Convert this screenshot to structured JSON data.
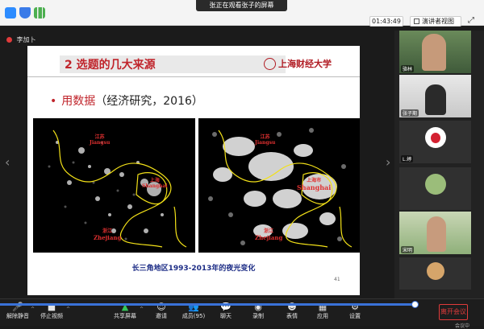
{
  "window": {
    "share_banner": "张正在观看张子的屏幕",
    "timer": "01:43:49",
    "view_button": "演讲者视图",
    "speaker_name": "李加卜"
  },
  "slide": {
    "title": "2 选题的几大来源",
    "logo_text": "上海财经大学",
    "bullet_prefix": "用数据",
    "bullet_rest": "（经济研究，2016）",
    "caption": "长三角地区1993-2013年的夜光变化",
    "page_number": "41",
    "map_left": {
      "label_top_cn": "江苏",
      "label_top_en": "Jiangsu",
      "label_mid_cn": "上海",
      "label_mid_en": "Shanghai",
      "label_bot_cn": "浙江",
      "label_bot_en": "Zhejiang"
    },
    "map_right": {
      "label_top_cn": "江苏",
      "label_top_en": "Jiangsu",
      "label_mid_cn": "上海市",
      "label_mid_en": "Shanghai",
      "label_bot_cn": "浙江",
      "label_bot_en": "Zhejiang"
    }
  },
  "participants": [
    {
      "name": "骆林"
    },
    {
      "name": "张子期"
    },
    {
      "name": "L.婷"
    },
    {
      "name": ""
    },
    {
      "name": "宋明"
    },
    {
      "name": ""
    }
  ],
  "toolbar": {
    "mute_label": "解除静音",
    "video_label": "停止视频",
    "share_label": "共享屏幕",
    "invite_label": "邀请",
    "members_label": "成员(95)",
    "chat_label": "聊天",
    "record_label": "录制",
    "reactions_label": "表情",
    "apps_label": "应用",
    "settings_label": "设置",
    "end_label": "离开会议",
    "end_sub": "会议中"
  }
}
